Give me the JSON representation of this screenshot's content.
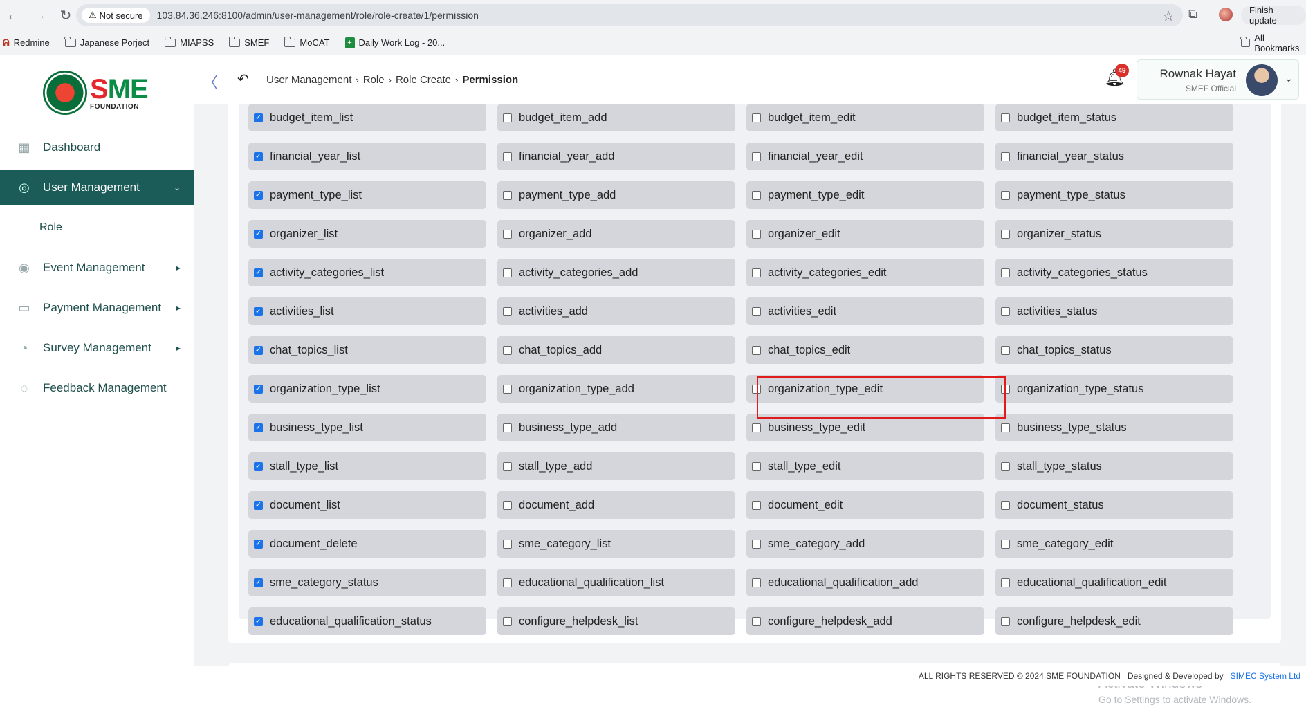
{
  "browser": {
    "security": "Not secure",
    "url": "103.84.36.246:8100/admin/user-management/role/role-create/1/permission",
    "finish_update": "Finish update",
    "bookmarks": [
      "Redmine",
      "Japanese Porject",
      "MIAPSS",
      "SMEF",
      "MoCAT",
      "Daily Work Log - 20..."
    ],
    "all_bookmarks": "All Bookmarks"
  },
  "logo": {
    "brand": "SME",
    "subtitle": "FOUNDATION"
  },
  "sidebar": {
    "items": [
      {
        "label": "Dashboard",
        "icon": "grid-icon"
      },
      {
        "label": "User Management",
        "icon": "user-shield-icon",
        "active": true
      },
      {
        "label": "Role",
        "sub": true
      },
      {
        "label": "Event Management",
        "icon": "event-icon"
      },
      {
        "label": "Payment Management",
        "icon": "payment-icon"
      },
      {
        "label": "Survey Management",
        "icon": "survey-icon"
      },
      {
        "label": "Feedback Management",
        "icon": "feedback-icon"
      }
    ]
  },
  "header": {
    "breadcrumb": [
      "User Management",
      "Role",
      "Role Create",
      "Permission"
    ],
    "notification_count": "49",
    "user_name": "Rownak Hayat",
    "user_role": "SMEF Official"
  },
  "permissions": [
    {
      "label": "budget_item_list",
      "checked": true
    },
    {
      "label": "budget_item_add",
      "checked": false
    },
    {
      "label": "budget_item_edit",
      "checked": false
    },
    {
      "label": "budget_item_status",
      "checked": false
    },
    {
      "label": "financial_year_list",
      "checked": true
    },
    {
      "label": "financial_year_add",
      "checked": false
    },
    {
      "label": "financial_year_edit",
      "checked": false
    },
    {
      "label": "financial_year_status",
      "checked": false
    },
    {
      "label": "payment_type_list",
      "checked": true
    },
    {
      "label": "payment_type_add",
      "checked": false
    },
    {
      "label": "payment_type_edit",
      "checked": false
    },
    {
      "label": "payment_type_status",
      "checked": false
    },
    {
      "label": "organizer_list",
      "checked": true
    },
    {
      "label": "organizer_add",
      "checked": false
    },
    {
      "label": "organizer_edit",
      "checked": false
    },
    {
      "label": "organizer_status",
      "checked": false
    },
    {
      "label": "activity_categories_list",
      "checked": true
    },
    {
      "label": "activity_categories_add",
      "checked": false
    },
    {
      "label": "activity_categories_edit",
      "checked": false
    },
    {
      "label": "activity_categories_status",
      "checked": false
    },
    {
      "label": "activities_list",
      "checked": true
    },
    {
      "label": "activities_add",
      "checked": false
    },
    {
      "label": "activities_edit",
      "checked": false
    },
    {
      "label": "activities_status",
      "checked": false
    },
    {
      "label": "chat_topics_list",
      "checked": true
    },
    {
      "label": "chat_topics_add",
      "checked": false
    },
    {
      "label": "chat_topics_edit",
      "checked": false
    },
    {
      "label": "chat_topics_status",
      "checked": false
    },
    {
      "label": "organization_type_list",
      "checked": true
    },
    {
      "label": "organization_type_add",
      "checked": false
    },
    {
      "label": "organization_type_edit",
      "checked": false
    },
    {
      "label": "organization_type_status",
      "checked": false
    },
    {
      "label": "business_type_list",
      "checked": true
    },
    {
      "label": "business_type_add",
      "checked": false
    },
    {
      "label": "business_type_edit",
      "checked": false
    },
    {
      "label": "business_type_status",
      "checked": false
    },
    {
      "label": "stall_type_list",
      "checked": true
    },
    {
      "label": "stall_type_add",
      "checked": false
    },
    {
      "label": "stall_type_edit",
      "checked": false
    },
    {
      "label": "stall_type_status",
      "checked": false
    },
    {
      "label": "document_list",
      "checked": true
    },
    {
      "label": "document_add",
      "checked": false
    },
    {
      "label": "document_edit",
      "checked": false
    },
    {
      "label": "document_status",
      "checked": false
    },
    {
      "label": "document_delete",
      "checked": true
    },
    {
      "label": "sme_category_list",
      "checked": false
    },
    {
      "label": "sme_category_add",
      "checked": false
    },
    {
      "label": "sme_category_edit",
      "checked": false
    },
    {
      "label": "sme_category_status",
      "checked": true
    },
    {
      "label": "educational_qualification_list",
      "checked": false
    },
    {
      "label": "educational_qualification_add",
      "checked": false
    },
    {
      "label": "educational_qualification_edit",
      "checked": false
    },
    {
      "label": "educational_qualification_status",
      "checked": true
    },
    {
      "label": "configure_helpdesk_list",
      "checked": false
    },
    {
      "label": "configure_helpdesk_add",
      "checked": false
    },
    {
      "label": "configure_helpdesk_edit",
      "checked": false
    }
  ],
  "watermark": {
    "line1": "Activate Windows",
    "line2": "Go to Settings to activate Windows."
  },
  "footer": {
    "rights": "ALL RIGHTS RESERVED © 2024 SME FOUNDATION",
    "designed": "Designed & Developed by",
    "company": "SIMEC System Ltd"
  },
  "colors": {
    "accent": "#1c5c58",
    "checkbox": "#1a73e8",
    "highlight": "#e01b1b"
  }
}
